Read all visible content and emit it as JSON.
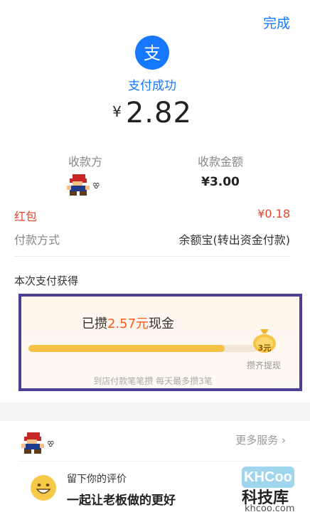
{
  "header": {
    "done_label": "完成"
  },
  "payment": {
    "logo_icon": "alipay-icon",
    "status": "支付成功",
    "currency": "¥",
    "amount": "2.82"
  },
  "details": {
    "payee_label": "收款方",
    "amount_label": "收款金额",
    "received_amount": "¥3.00",
    "red_packet_label": "红包",
    "red_packet_value": "¥0.18",
    "method_label": "付款方式",
    "method_value": "余额宝(转出资金付款)"
  },
  "earned": {
    "title": "本次支付获得",
    "saved_prefix": "已攒",
    "saved_amount": "2.57元",
    "saved_suffix": "现金",
    "progress": 0.857,
    "bag_value": "3元",
    "bag_caption": "攒齐提现",
    "note": "到店付款笔笔攒 每天最多攒3笔"
  },
  "services": {
    "more_label": "更多服务 ›",
    "review_title": "留下你的评价",
    "review_subtitle": "一起让老板做的更好"
  },
  "watermark": {
    "logo": "KHCoo",
    "name": "科技库",
    "url": "khcoo.com"
  },
  "colors": {
    "brand_blue": "#1677ff",
    "red": "#e8452c",
    "highlight_orange": "#ff5a1f",
    "progress_yellow": "#f6c344",
    "annotation_border": "#4a3f95"
  }
}
